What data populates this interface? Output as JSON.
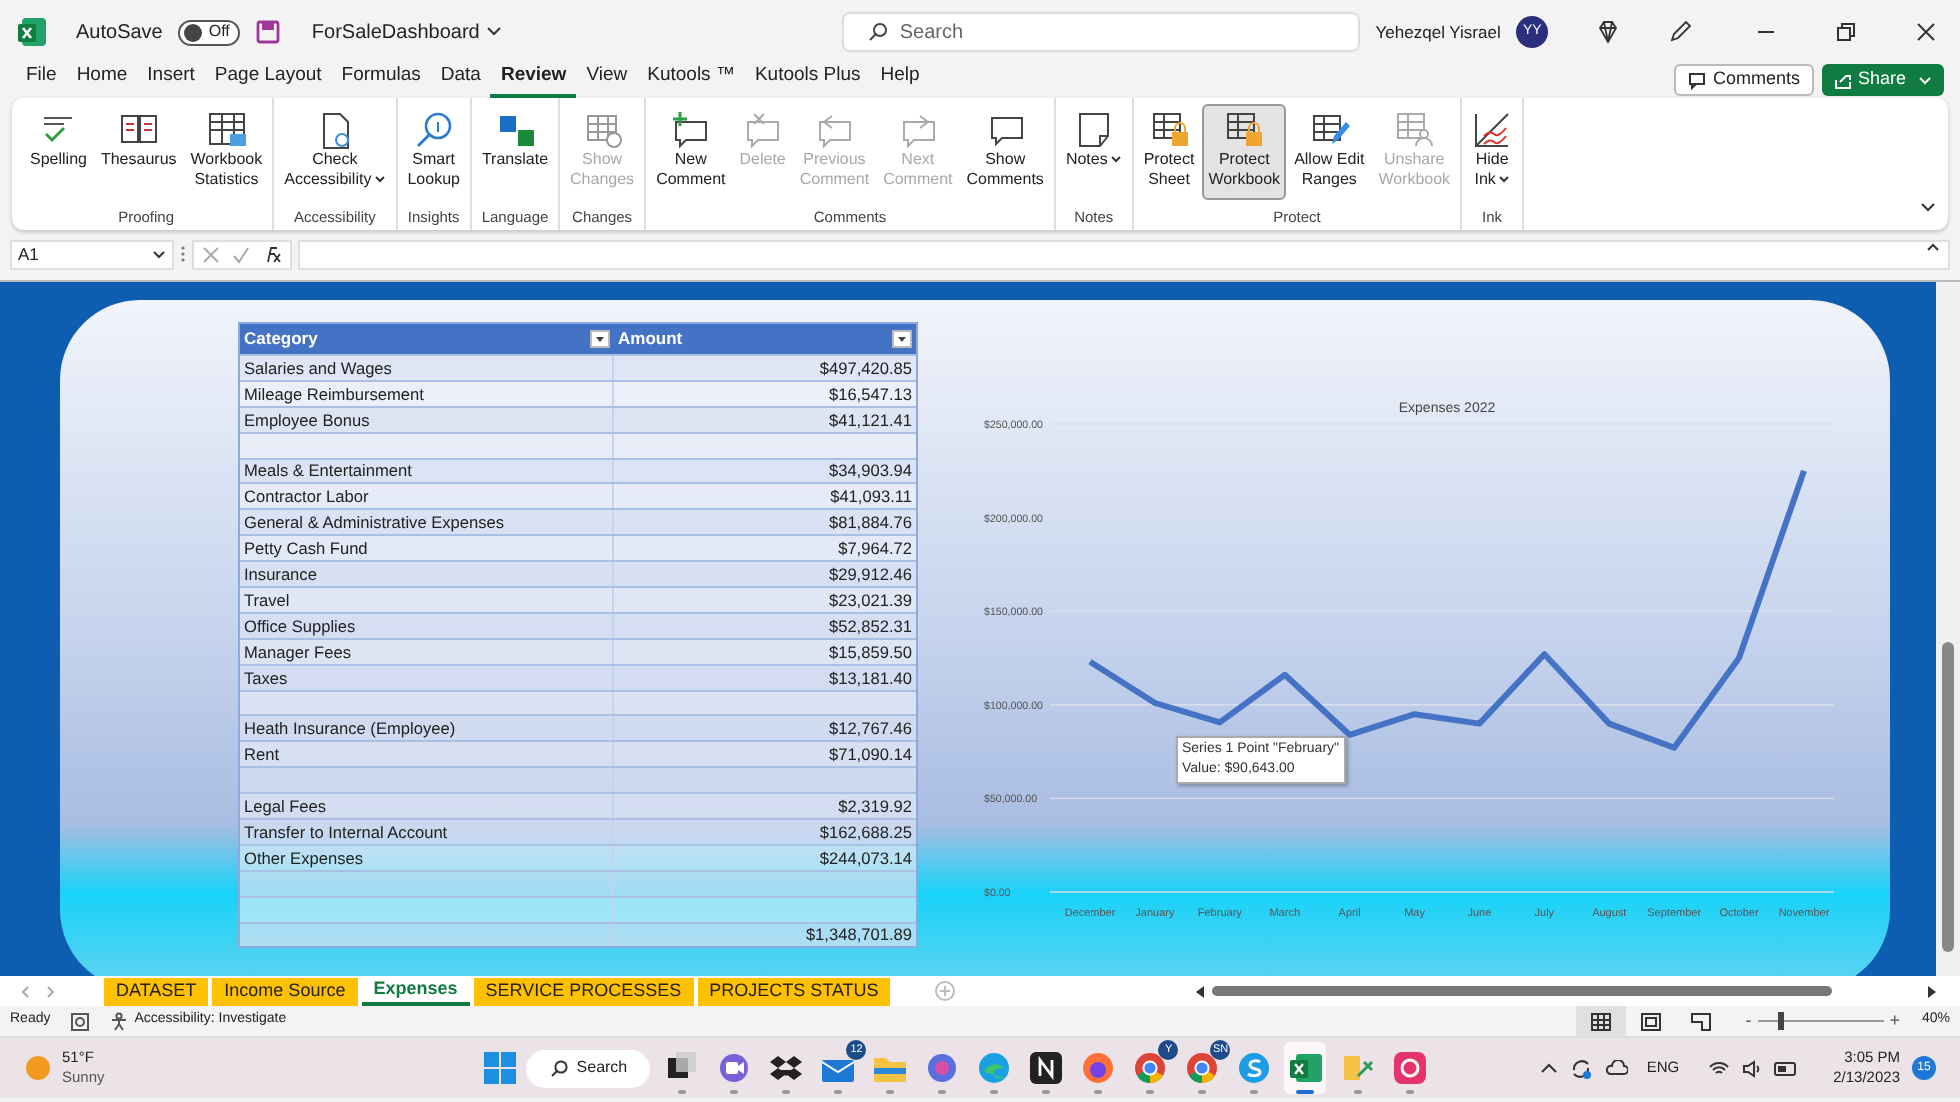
{
  "title_bar": {
    "autosave_label": "AutoSave",
    "autosave": {
      "on": false,
      "label": "Off"
    },
    "file_name": "ForSaleDashboard",
    "search_placeholder": "Search",
    "user_name": "Yehezqel Yisrael",
    "avatar_initials": "YY"
  },
  "menu_tabs": [
    {
      "label": "File",
      "selected": false
    },
    {
      "label": "Home",
      "selected": false
    },
    {
      "label": "Insert",
      "selected": false
    },
    {
      "label": "Page Layout",
      "selected": false
    },
    {
      "label": "Formulas",
      "selected": false
    },
    {
      "label": "Data",
      "selected": false
    },
    {
      "label": "Review",
      "selected": true
    },
    {
      "label": "View",
      "selected": false
    },
    {
      "label": "Kutools ™",
      "selected": false
    },
    {
      "label": "Kutools Plus",
      "selected": false
    },
    {
      "label": "Help",
      "selected": false
    }
  ],
  "header_buttons": [
    {
      "kind": "outline",
      "label": "Comments"
    },
    {
      "kind": "primary",
      "label": "Share"
    }
  ],
  "ribbon": {
    "groups": [
      {
        "label": "Proofing",
        "buttons": [
          {
            "lines": [
              "Spelling"
            ],
            "disabled": false,
            "selected": false,
            "dropdown": false
          },
          {
            "lines": [
              "Thesaurus"
            ],
            "disabled": false,
            "selected": false,
            "dropdown": false
          },
          {
            "lines": [
              "Workbook",
              "Statistics"
            ],
            "disabled": false,
            "selected": false,
            "dropdown": false
          }
        ]
      },
      {
        "label": "Accessibility",
        "buttons": [
          {
            "lines": [
              "Check",
              "Accessibility"
            ],
            "disabled": false,
            "selected": false,
            "dropdown": true
          }
        ]
      },
      {
        "label": "Insights",
        "buttons": [
          {
            "lines": [
              "Smart",
              "Lookup"
            ],
            "disabled": false,
            "selected": false,
            "dropdown": false
          }
        ]
      },
      {
        "label": "Language",
        "buttons": [
          {
            "lines": [
              "Translate"
            ],
            "disabled": false,
            "selected": false,
            "dropdown": false
          }
        ]
      },
      {
        "label": "Changes",
        "buttons": [
          {
            "lines": [
              "Show",
              "Changes"
            ],
            "disabled": true,
            "selected": false,
            "dropdown": false
          }
        ]
      },
      {
        "label": "Comments",
        "buttons": [
          {
            "lines": [
              "New",
              "Comment"
            ],
            "disabled": false,
            "selected": false,
            "dropdown": false
          },
          {
            "lines": [
              "Delete"
            ],
            "disabled": true,
            "selected": false,
            "dropdown": false
          },
          {
            "lines": [
              "Previous",
              "Comment"
            ],
            "disabled": true,
            "selected": false,
            "dropdown": false
          },
          {
            "lines": [
              "Next",
              "Comment"
            ],
            "disabled": true,
            "selected": false,
            "dropdown": false
          },
          {
            "lines": [
              "Show",
              "Comments"
            ],
            "disabled": false,
            "selected": false,
            "dropdown": false
          }
        ]
      },
      {
        "label": "Notes",
        "buttons": [
          {
            "lines": [
              "Notes"
            ],
            "disabled": false,
            "selected": false,
            "dropdown": true
          }
        ]
      },
      {
        "label": "Protect",
        "buttons": [
          {
            "lines": [
              "Protect",
              "Sheet"
            ],
            "disabled": false,
            "selected": false,
            "dropdown": false
          },
          {
            "lines": [
              "Protect",
              "Workbook"
            ],
            "disabled": false,
            "selected": true,
            "dropdown": false
          },
          {
            "lines": [
              "Allow Edit",
              "Ranges"
            ],
            "disabled": false,
            "selected": false,
            "dropdown": false
          },
          {
            "lines": [
              "Unshare",
              "Workbook"
            ],
            "disabled": true,
            "selected": false,
            "dropdown": false
          }
        ]
      },
      {
        "label": "Ink",
        "buttons": [
          {
            "lines": [
              "Hide",
              "Ink"
            ],
            "disabled": false,
            "selected": false,
            "dropdown": true
          }
        ]
      }
    ]
  },
  "formula_bar": {
    "name_box": "A1"
  },
  "sheet": {
    "table": {
      "columns": [
        "Category",
        "Amount"
      ],
      "rows": [
        {
          "kind": "item",
          "category": "Salaries and Wages",
          "amount": "$497,420.85"
        },
        {
          "kind": "item",
          "category": "Mileage Reimbursement",
          "amount": "$16,547.13"
        },
        {
          "kind": "item",
          "category": "Employee Bonus",
          "amount": "$41,121.41"
        },
        {
          "kind": "blank"
        },
        {
          "kind": "item",
          "category": "Meals & Entertainment",
          "amount": "$34,903.94"
        },
        {
          "kind": "item",
          "category": "Contractor Labor",
          "amount": "$41,093.11"
        },
        {
          "kind": "item",
          "category": "General & Administrative Expenses",
          "amount": "$81,884.76"
        },
        {
          "kind": "item",
          "category": "Petty Cash Fund",
          "amount": "$7,964.72"
        },
        {
          "kind": "item",
          "category": "Insurance",
          "amount": "$29,912.46"
        },
        {
          "kind": "item",
          "category": "Travel",
          "amount": "$23,021.39"
        },
        {
          "kind": "item",
          "category": "Office Supplies",
          "amount": "$52,852.31"
        },
        {
          "kind": "item",
          "category": "Manager Fees",
          "amount": "$15,859.50"
        },
        {
          "kind": "item",
          "category": "Taxes",
          "amount": "$13,181.40"
        },
        {
          "kind": "blank"
        },
        {
          "kind": "item",
          "category": "Heath Insurance (Employee)",
          "amount": "$12,767.46"
        },
        {
          "kind": "item",
          "category": "Rent",
          "amount": "$71,090.14"
        },
        {
          "kind": "blank"
        },
        {
          "kind": "item",
          "category": "Legal Fees",
          "amount": "$2,319.92"
        },
        {
          "kind": "item",
          "category": "Transfer to Internal Account",
          "amount": "$162,688.25"
        },
        {
          "kind": "item",
          "category": "Other Expenses",
          "amount": "$244,073.14"
        },
        {
          "kind": "blank"
        },
        {
          "kind": "blank"
        },
        {
          "kind": "total",
          "amount": "$1,348,701.89"
        }
      ]
    },
    "chart_data": {
      "type": "line",
      "title": "Expenses 2022",
      "categories": [
        "December",
        "January",
        "February",
        "March",
        "April",
        "May",
        "June",
        "July",
        "August",
        "September",
        "October",
        "November"
      ],
      "grid": true,
      "series": [
        {
          "color": "#4472c4",
          "values": [
            123000,
            101000,
            90643,
            116000,
            84000,
            95000,
            90000,
            127000,
            90000,
            77000,
            125000,
            225000
          ]
        }
      ],
      "ylim": [
        0,
        250000
      ],
      "yticks": [
        {
          "value": 0,
          "label": "$0.00"
        },
        {
          "value": 50000,
          "label": "$50,000.00"
        },
        {
          "value": 100000,
          "label": "$100,000.00"
        },
        {
          "value": 150000,
          "label": "$150,000.00"
        },
        {
          "value": 200000,
          "label": "$200,000.00"
        },
        {
          "value": 250000,
          "label": "$250,000.00"
        }
      ]
    },
    "tooltip": {
      "lines": [
        "Series 1 Point \"February\"",
        "Value: $90,643.00"
      ]
    }
  },
  "sheet_tabs": [
    {
      "label": "DATASET",
      "selected": false
    },
    {
      "label": "Income Source",
      "selected": false
    },
    {
      "label": "Expenses",
      "selected": true
    },
    {
      "label": "SERVICE PROCESSES",
      "selected": false
    },
    {
      "label": "PROJECTS STATUS",
      "selected": false
    }
  ],
  "status_bar": {
    "status": "Ready",
    "accessibility": "Accessibility: Investigate",
    "views": [
      {
        "selected": true
      },
      {
        "selected": false
      },
      {
        "selected": false
      }
    ],
    "zoom": {
      "minus": "-",
      "plus": "+",
      "level": 0.18,
      "reading": "40%"
    }
  },
  "taskbar": {
    "weather": {
      "temperature": "51°F",
      "condition": "Sunny"
    },
    "search": "Search",
    "apps": [
      {
        "selected": false
      },
      {
        "selected": false
      },
      {
        "selected": false
      },
      {
        "selected": false,
        "badge": "12"
      },
      {
        "selected": false
      },
      {
        "selected": false
      },
      {
        "selected": false
      },
      {
        "selected": false
      },
      {
        "selected": false
      },
      {
        "selected": false,
        "badge": "Y"
      },
      {
        "selected": false,
        "badge": "SN"
      },
      {
        "selected": false
      },
      {
        "selected": true
      },
      {
        "selected": false
      },
      {
        "selected": false
      }
    ],
    "tray": {
      "language": "ENG",
      "time": "3:05 PM",
      "date": "2/13/2023",
      "notifications": "15"
    }
  }
}
